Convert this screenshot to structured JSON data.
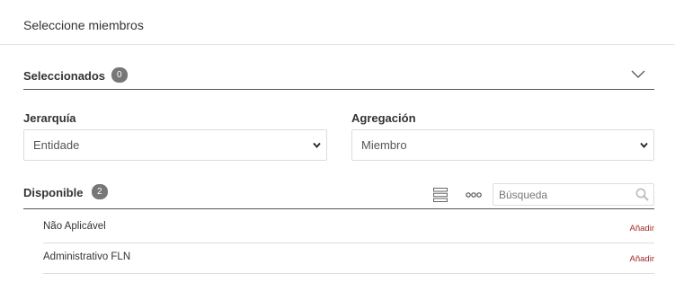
{
  "header": {
    "title": "Seleccione miembros"
  },
  "selected": {
    "label": "Seleccionados",
    "count": "0"
  },
  "hierarchy": {
    "label": "Jerarquía",
    "value": "Entidade"
  },
  "aggregation": {
    "label": "Agregación",
    "value": "Miembro"
  },
  "available": {
    "label": "Disponible",
    "count": "2"
  },
  "search": {
    "placeholder": "Búsqueda",
    "value": ""
  },
  "members": [
    {
      "name": "Não Aplicável",
      "action": "Añadir"
    },
    {
      "name": "Administrativo FLN",
      "action": "Añadir"
    }
  ],
  "icons": {
    "collapse": "chevron-down-icon",
    "list_view": "list-view-icon",
    "more": "more-options-icon",
    "search": "search-icon"
  },
  "colors": {
    "add_link": "#a52a2a",
    "badge": "#777777",
    "divider": "#555555"
  }
}
